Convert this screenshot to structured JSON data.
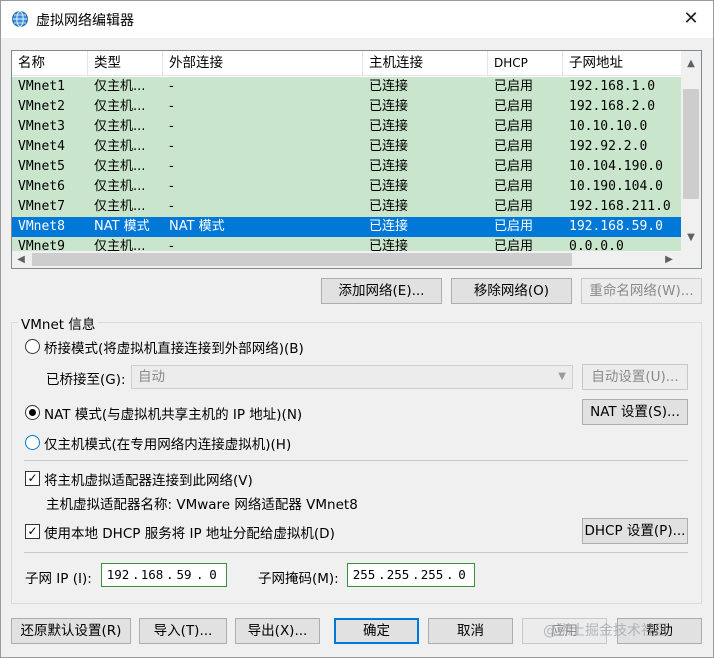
{
  "window": {
    "title": "虚拟网络编辑器",
    "close_glyph": "✕"
  },
  "table": {
    "columns": [
      "名称",
      "类型",
      "外部连接",
      "主机连接",
      "DHCP",
      "子网地址"
    ],
    "rows": [
      {
        "name": "VMnet1",
        "type": "仅主机...",
        "external": "-",
        "host": "已连接",
        "dhcp": "已启用",
        "subnet": "192.168.1.0"
      },
      {
        "name": "VMnet2",
        "type": "仅主机...",
        "external": "-",
        "host": "已连接",
        "dhcp": "已启用",
        "subnet": "192.168.2.0"
      },
      {
        "name": "VMnet3",
        "type": "仅主机...",
        "external": "-",
        "host": "已连接",
        "dhcp": "已启用",
        "subnet": "10.10.10.0"
      },
      {
        "name": "VMnet4",
        "type": "仅主机...",
        "external": "-",
        "host": "已连接",
        "dhcp": "已启用",
        "subnet": "192.92.2.0"
      },
      {
        "name": "VMnet5",
        "type": "仅主机...",
        "external": "-",
        "host": "已连接",
        "dhcp": "已启用",
        "subnet": "10.104.190.0"
      },
      {
        "name": "VMnet6",
        "type": "仅主机...",
        "external": "-",
        "host": "已连接",
        "dhcp": "已启用",
        "subnet": "10.190.104.0"
      },
      {
        "name": "VMnet7",
        "type": "仅主机...",
        "external": "-",
        "host": "已连接",
        "dhcp": "已启用",
        "subnet": "192.168.211.0"
      },
      {
        "name": "VMnet8",
        "type": "NAT 模式",
        "external": "NAT 模式",
        "host": "已连接",
        "dhcp": "已启用",
        "subnet": "192.168.59.0"
      },
      {
        "name": "VMnet9",
        "type": "仅主机...",
        "external": "-",
        "host": "已连接",
        "dhcp": "已启用",
        "subnet": "0.0.0.0"
      }
    ],
    "selected_row": "VMnet8"
  },
  "list_buttons": {
    "add": "添加网络(E)...",
    "remove": "移除网络(O)",
    "rename": "重命名网络(W)..."
  },
  "vmnet_info": {
    "group_label": "VMnet 信息",
    "bridged_label": "桥接模式(将虚拟机直接连接到外部网络)(B)",
    "bridged_to_label": "已桥接至(G):",
    "bridged_to_value": "自动",
    "auto_settings": "自动设置(U)...",
    "nat_label": "NAT 模式(与虚拟机共享主机的 IP 地址)(N)",
    "nat_settings": "NAT 设置(S)...",
    "hostonly_label": "仅主机模式(在专用网络内连接虚拟机)(H)",
    "connect_adapter_label": "将主机虚拟适配器连接到此网络(V)",
    "adapter_name_label": "主机虚拟适配器名称: VMware 网络适配器 VMnet8",
    "dhcp_label": "使用本地 DHCP 服务将 IP 地址分配给虚拟机(D)",
    "dhcp_settings": "DHCP 设置(P)...",
    "subnet_ip_label": "子网 IP (I):",
    "subnet_ip": [
      "192",
      "168",
      "59",
      "0"
    ],
    "subnet_mask_label": "子网掩码(M):",
    "subnet_mask": [
      "255",
      "255",
      "255",
      "0"
    ],
    "selected_mode": "nat"
  },
  "footer": {
    "restore": "还原默认设置(R)",
    "import": "导入(T)...",
    "export": "导出(X)...",
    "ok": "确定",
    "cancel": "取消",
    "apply": "应用",
    "help": "帮助"
  },
  "watermark": "@稀土掘金技术社区"
}
